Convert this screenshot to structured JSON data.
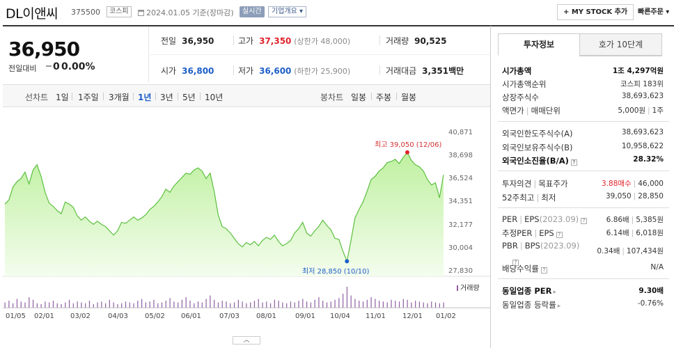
{
  "header": {
    "title": "DL이앤씨",
    "code": "375500",
    "market": "코스피",
    "date": "2024.01.05",
    "date_suffix": "기준(장마감)",
    "live_label": "실시간",
    "company_label": "기업개요",
    "mystock_label": "+ MY STOCK 추가",
    "quick_order_label": "빠른주문"
  },
  "quote": {
    "price": "36,950",
    "change_label": "전일대비",
    "change_value": "0",
    "change_pct": "0.00%",
    "prev_close_label": "전일",
    "prev_close": "36,950",
    "high_label": "고가",
    "high": "37,350",
    "upper_limit": "(상한가 48,000)",
    "volume_label": "거래량",
    "volume": "90,525",
    "open_label": "시가",
    "open": "36,800",
    "low_label": "저가",
    "low": "36,600",
    "lower_limit": "(하한가 25,900)",
    "amount_label": "거래대금",
    "amount": "3,351",
    "amount_unit": "백만"
  },
  "chart_tabs": {
    "line_label": "선차트",
    "line_periods": [
      "1일",
      "1주일",
      "3개월",
      "1년",
      "3년",
      "5년",
      "10년"
    ],
    "active_period": "1년",
    "candle_label": "봉차트",
    "candle_periods": [
      "일봉",
      "주봉",
      "월봉"
    ]
  },
  "chart_data": {
    "type": "area",
    "y_ticks": [
      "40,871",
      "38,698",
      "36,524",
      "34,351",
      "32,177",
      "30,004",
      "27,830"
    ],
    "ylim": [
      27830,
      40871
    ],
    "x_ticks": [
      "01/05",
      "02/01",
      "03/02",
      "04/03",
      "05/02",
      "06/01",
      "07/03",
      "08/01",
      "09/01",
      "10/04",
      "11/01",
      "12/01",
      "01/02"
    ],
    "series": [
      {
        "values": [
          34200,
          34600,
          35800,
          36300,
          36600,
          37200,
          36100,
          37400,
          37900,
          36800,
          35300,
          34300,
          34000,
          33600,
          33300,
          34400,
          34200,
          33900,
          33100,
          32700,
          33000,
          32600,
          32300,
          32600,
          32300,
          32100,
          31700,
          31300,
          31700,
          32500,
          32400,
          32700,
          33000,
          32700,
          32900,
          33200,
          33700,
          34000,
          34400,
          34900,
          35600,
          35300,
          35900,
          36300,
          36700,
          37100,
          37000,
          37400,
          37600,
          37300,
          36600,
          37100,
          35400,
          33200,
          32100,
          31900,
          31500,
          31000,
          30500,
          30200,
          30600,
          30400,
          30700,
          30300,
          30800,
          31100,
          30900,
          31300,
          30700,
          30300,
          30500,
          30800,
          31500,
          31900,
          32500,
          31500,
          31200,
          31700,
          32100,
          32700,
          32200,
          31800,
          31000,
          30900,
          29800,
          28850,
          30800,
          32900,
          33700,
          34400,
          35400,
          36500,
          36800,
          37300,
          37600,
          38100,
          38200,
          38400,
          38000,
          38600,
          39050,
          38300,
          37900,
          37700,
          37300,
          36500,
          36000,
          36200,
          34800,
          36950
        ],
        "volume": [
          6,
          8,
          5,
          10,
          7,
          6,
          12,
          9,
          5,
          4,
          7,
          6,
          8,
          5,
          4,
          6,
          9,
          5,
          7,
          6,
          5,
          8,
          4,
          6,
          7,
          5,
          9,
          6,
          4,
          5,
          7,
          6,
          5,
          8,
          10,
          6,
          7,
          9,
          5,
          6,
          8,
          11,
          7,
          6,
          9,
          12,
          8,
          5,
          7,
          6,
          10,
          14,
          9,
          6,
          8,
          7,
          5,
          6,
          9,
          7,
          5,
          6,
          8,
          10,
          6,
          7,
          5,
          9,
          8,
          6,
          5,
          7,
          6,
          8,
          10,
          7,
          6,
          9,
          12,
          8,
          6,
          7,
          9,
          11,
          16,
          24,
          14,
          10,
          8,
          7,
          9,
          12,
          10,
          8,
          7,
          6,
          9,
          8,
          7,
          10,
          9,
          6,
          8,
          7,
          6,
          5,
          7,
          6,
          5,
          6
        ],
        "high_point": {
          "index": 100,
          "label": "최고 39,050 (12/06)"
        },
        "low_point": {
          "index": 85,
          "label": "최저 28,850 (10/10)"
        }
      }
    ],
    "volume_label": "거래량",
    "grid": false
  },
  "panel": {
    "tabs": [
      "투자정보",
      "호가 10단계"
    ],
    "active_tab": "투자정보",
    "market_cap": {
      "label": "시가총액",
      "value": "1조 4,297억원"
    },
    "market_cap_rank": {
      "label": "시가총액순위",
      "value": "코스피 183위"
    },
    "shares": {
      "label": "상장주식수",
      "value": "38,693,623"
    },
    "par": {
      "label": "액면가",
      "label2": "매매단위",
      "value": "5,000원",
      "value2": "1주"
    },
    "foreign_limit": {
      "label": "외국인한도주식수(A)",
      "value": "38,693,623"
    },
    "foreign_hold": {
      "label": "외국인보유주식수(B)",
      "value": "10,958,622"
    },
    "foreign_rate": {
      "label": "외국인소진율(B/A)",
      "value": "28.32%"
    },
    "opinion": {
      "label": "투자의견",
      "label2": "목표주가",
      "value": "3.88매수",
      "value2": "46,000"
    },
    "week52": {
      "label": "52주최고",
      "label2": "최저",
      "value": "39,050",
      "value2": "28,850"
    },
    "per": {
      "label": "PER",
      "label2": "EPS",
      "label3": "(2023.09)",
      "value": "6.86배",
      "value2": "5,385원"
    },
    "est_per": {
      "label": "추정PER",
      "label2": "EPS",
      "value": "6.14배",
      "value2": "6,018원"
    },
    "pbr": {
      "label": "PBR",
      "label2": "BPS",
      "label3": "(2023.09)",
      "value": "0.34배",
      "value2": "107,434원"
    },
    "dividend": {
      "label": "배당수익률",
      "value": "N/A"
    },
    "sector_per": {
      "label": "동일업종 PER",
      "value": "9.30배"
    },
    "sector_rate": {
      "label": "동일업종 등락률",
      "value": "-0.76%"
    }
  }
}
